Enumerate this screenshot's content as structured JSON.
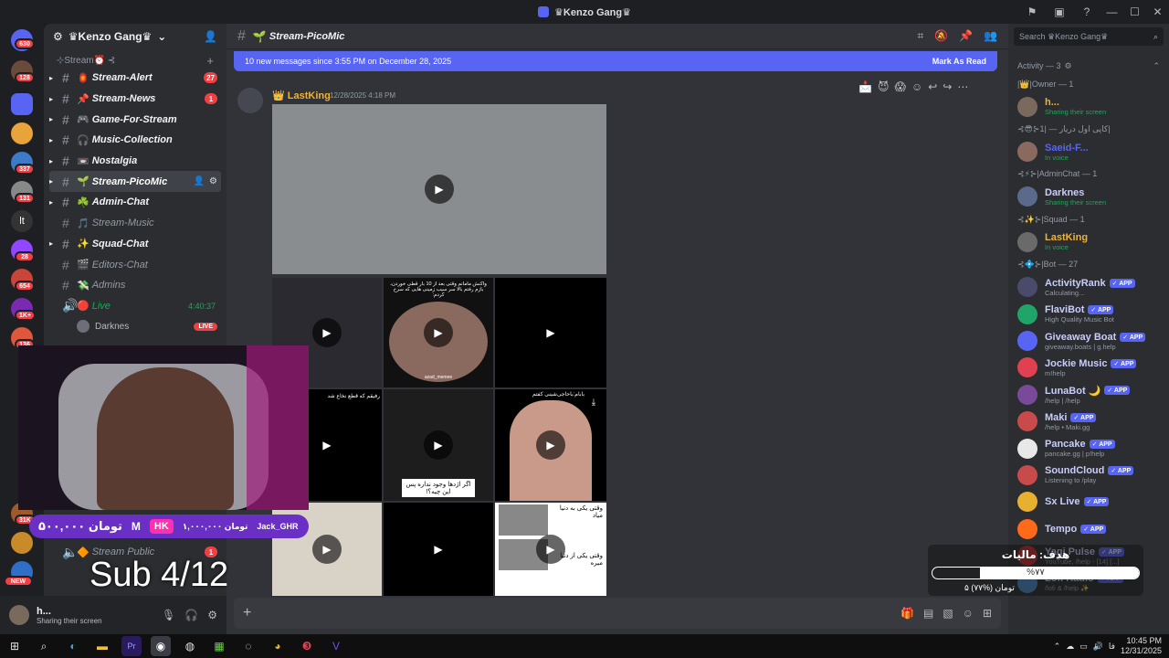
{
  "window": {
    "title": "♛Kenzo Gang♛"
  },
  "title_icons": [
    "inbox-icon",
    "screen-share-icon",
    "help-icon"
  ],
  "server_badges": [
    "630",
    "128",
    "337",
    "131",
    "28",
    "654",
    "1K+",
    "136",
    "31K",
    "NEW"
  ],
  "guild": {
    "name": "♛Kenzo Gang♛"
  },
  "category": "⊹Stream⏰ ⊰",
  "channels": [
    {
      "emo": "🏮",
      "name": "Stream-Alert",
      "badge": "27",
      "state": "bright"
    },
    {
      "emo": "📌",
      "name": "Stream-News",
      "badge": "1",
      "state": "bright"
    },
    {
      "emo": "🎮",
      "name": "Game-For-Stream",
      "badge": "",
      "state": "bright"
    },
    {
      "emo": "🎧",
      "name": "Music-Collection",
      "badge": "",
      "state": "bright"
    },
    {
      "emo": "📼",
      "name": "Nostalgia",
      "badge": "",
      "state": "bright"
    },
    {
      "emo": "🌱",
      "name": "Stream-PicoMic",
      "badge": "",
      "state": "active"
    },
    {
      "emo": "☘️",
      "name": "Admin-Chat",
      "badge": "",
      "state": "bright"
    },
    {
      "emo": "🎵",
      "name": "Stream-Music",
      "badge": "",
      "state": "muted"
    },
    {
      "emo": "✨",
      "name": "Squad-Chat",
      "badge": "",
      "state": "bright"
    },
    {
      "emo": "🎬",
      "name": "Editors-Chat",
      "badge": "",
      "state": "muted"
    },
    {
      "emo": "💸",
      "name": "Admins",
      "badge": "",
      "state": "muted"
    }
  ],
  "live_channel": {
    "name": "Live",
    "timer": "4:40:37"
  },
  "voice_user": {
    "name": "Darknes",
    "badge": "LIVE"
  },
  "stream_public": {
    "name": "Stream Public",
    "badge": "1"
  },
  "user_panel": {
    "name": "h...",
    "status": "Sharing their screen"
  },
  "main": {
    "channel_name": "Stream-PicoMic",
    "new_messages": "10 new messages since 3:55 PM on December 28, 2025",
    "mark_as_read": "Mark As Read",
    "message": {
      "author": "LastKing",
      "timestamp": "12/28/2025 4:18 PM"
    },
    "media_captions": [
      "واکنش ماما‌نم وقتی بعد از 10 بار قطی خوردن، بازم رفتم بالا سر سیب زمینی هایی که سرخ کردم:",
      "azad_memee",
      "رفیقم که قطع نخاع شد",
      "بابام:باحاجی‌شینی کفتم",
      "اگر اژدها وجود نداره پس این چیه؟!",
      "وقتی یکی به دنیا میاد",
      "وقتی یکی از دنیا میره"
    ]
  },
  "members": {
    "search_placeholder": "Search ♛Kenzo Gang♛",
    "activity": "Activity — 3",
    "groups": [
      {
        "label": "|👑|Owner — 1",
        "members": [
          {
            "name": "h...",
            "sub": "Sharing their screen",
            "color": "#f0b232",
            "sub_green": true,
            "app": false
          }
        ]
      },
      {
        "label": "⊰😎⊱کاپی اول دریار — |1|",
        "members": [
          {
            "name": "Saeid-F...",
            "sub": "In voice",
            "color": "#5865f2",
            "sub_green": true,
            "app": false
          }
        ]
      },
      {
        "label": "⊰⚡⊱|AdminChat — 1",
        "members": [
          {
            "name": "Darknes",
            "sub": "Sharing their screen",
            "color": "#c9cdfb",
            "sub_green": true,
            "app": false
          }
        ]
      },
      {
        "label": "⊰✨⊱|Squad — 1",
        "members": [
          {
            "name": "LastKing",
            "sub": "In voice",
            "color": "#f0b232",
            "sub_green": true,
            "app": false
          }
        ]
      },
      {
        "label": "⊰💠⊱|Bot — 27",
        "members": [
          {
            "name": "ActivityRank",
            "sub": "Calculating...",
            "color": "#c9cdfb",
            "sub_green": false,
            "app": true
          },
          {
            "name": "FlaviBot",
            "sub": "High Quality Music Bot",
            "color": "#c9cdfb",
            "sub_green": false,
            "app": true
          },
          {
            "name": "Giveaway Boat",
            "sub": "giveaway.boats | g.help",
            "color": "#c9cdfb",
            "sub_green": false,
            "app": true
          },
          {
            "name": "Jockie Music",
            "sub": "m!help",
            "color": "#c9cdfb",
            "sub_green": false,
            "app": true
          },
          {
            "name": "LunaBot 🌙",
            "sub": "/help | /help",
            "color": "#c9cdfb",
            "sub_green": false,
            "app": true
          },
          {
            "name": "Maki",
            "sub": "/help • Maki.gg",
            "color": "#c9cdfb",
            "sub_green": false,
            "app": true
          },
          {
            "name": "Pancake",
            "sub": "pancake.gg | p!help",
            "color": "#c9cdfb",
            "sub_green": false,
            "app": true
          },
          {
            "name": "SoundCloud",
            "sub": "Listening to /play",
            "color": "#c9cdfb",
            "sub_green": false,
            "app": true
          },
          {
            "name": "Sx Live",
            "sub": "",
            "color": "#c9cdfb",
            "sub_green": false,
            "app": true
          },
          {
            "name": "Tempo",
            "sub": "",
            "color": "#c9cdfb",
            "sub_green": false,
            "app": true
          },
          {
            "name": "Yagi Pulse",
            "sub": "YouTube, /help - [14] [...]",
            "color": "#c9cdfb",
            "sub_green": false,
            "app": true
          },
          {
            "name": "Lofi Radio",
            "sub": "/lofi & /help ✨",
            "color": "#c9cdfb",
            "sub_green": false,
            "app": true
          }
        ]
      }
    ]
  },
  "overlay": {
    "donation_amount": "۵۰۰,۰۰۰ تومان",
    "donation_m": "M",
    "donation_hk": "HK",
    "donation_small": "۱,۰۰۰,۰۰۰ تومان",
    "donation_user": "Jack_GHR",
    "sub_text": "Sub 4/12",
    "goal_title": "هدف: مالیات",
    "goal_pct": "%۷۷",
    "goal_progress": 0.77,
    "goal_sub": "۵ تومان (%۷۷)"
  },
  "taskbar": {
    "time": "10:45 PM",
    "date": "12/31/2025",
    "lang": "فا"
  }
}
